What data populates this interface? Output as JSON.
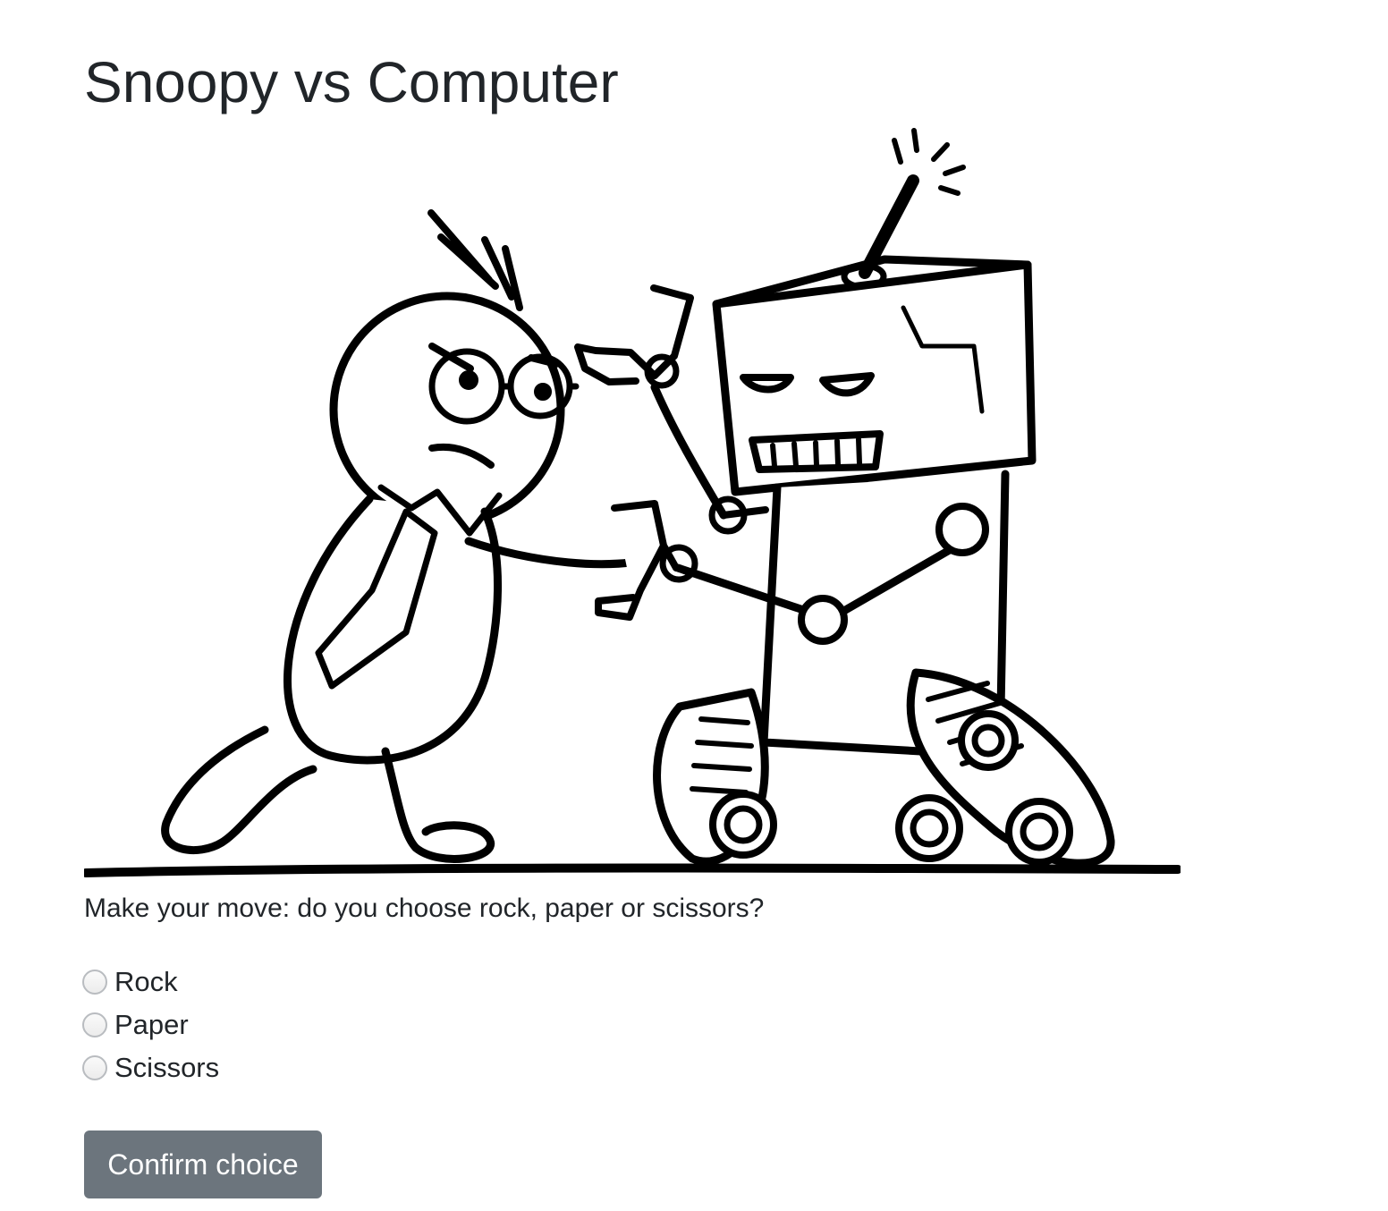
{
  "page": {
    "title": "Snoopy vs Computer",
    "prompt": "Make your move: do you choose rock, paper or scissors?"
  },
  "illustration": {
    "name": "man-vs-robot-illustration"
  },
  "choices": [
    {
      "label": "Rock",
      "selected": false
    },
    {
      "label": "Paper",
      "selected": false
    },
    {
      "label": "Scissors",
      "selected": false
    }
  ],
  "actions": {
    "confirm_label": "Confirm choice"
  },
  "colors": {
    "text": "#212529",
    "button_bg": "#6c757d",
    "button_text": "#ffffff"
  }
}
